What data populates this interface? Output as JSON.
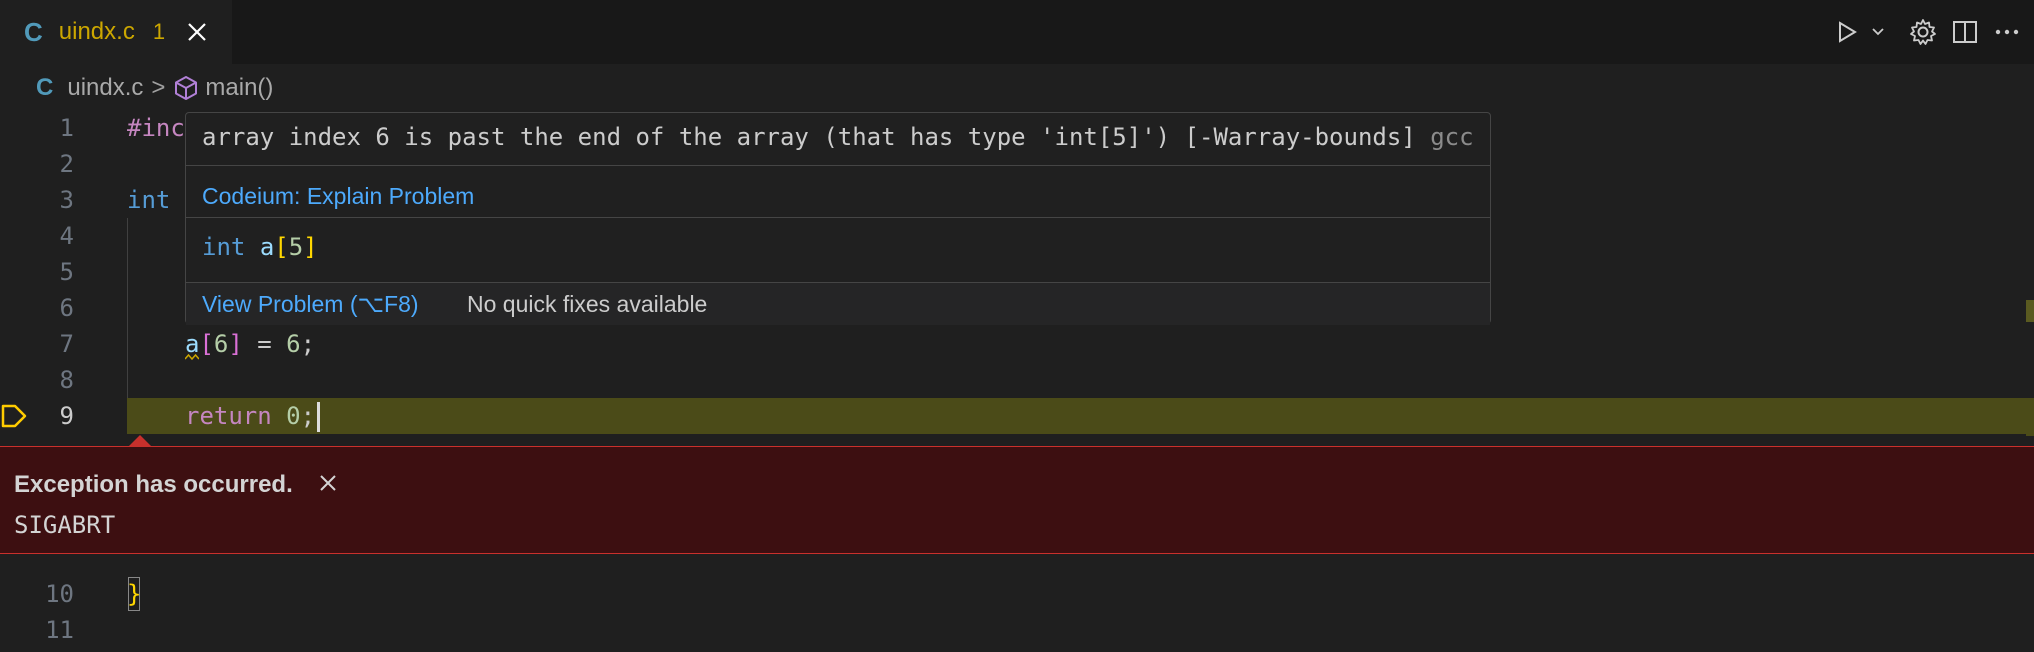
{
  "tab": {
    "lang_icon": "C",
    "label": "uindx.c",
    "problem_count": "1"
  },
  "breadcrumb": {
    "lang_icon": "C",
    "file": "uindx.c",
    "separator": ">",
    "symbol": "main()"
  },
  "editor": {
    "lines": [
      {
        "n": "1"
      },
      {
        "n": "2"
      },
      {
        "n": "3"
      },
      {
        "n": "4"
      },
      {
        "n": "5"
      },
      {
        "n": "6"
      },
      {
        "n": "7"
      },
      {
        "n": "8"
      },
      {
        "n": "9"
      },
      {
        "n": "10"
      },
      {
        "n": "11"
      }
    ],
    "line1": "#inc",
    "line3": "int",
    "line7": {
      "var": "a",
      "open": "[",
      "idx": "6",
      "close": "]",
      "rest": " = ",
      "val": "6",
      "semi": ";"
    },
    "line9": {
      "kw": "return",
      "val": "0",
      "semi": ";"
    },
    "line10": "}"
  },
  "hover": {
    "message": "array index 6 is past the end of the array (that has type 'int[5]') [-Warray-bounds]",
    "source": "gcc",
    "explain_link": "Codeium: Explain Problem",
    "decl_type": "int",
    "decl_name": "a",
    "decl_open": "[",
    "decl_size": "5",
    "decl_close": "]",
    "view_problem": "View Problem (⌥F8)",
    "no_quick_fixes": "No quick fixes available"
  },
  "exception": {
    "title": "Exception has occurred.",
    "detail": "SIGABRT"
  },
  "colors": {
    "accent": "#cca700",
    "link": "#4daafc",
    "exception_bg": "#3d0f11",
    "exception_border": "#c9302c",
    "current_line": "#4b4b18"
  },
  "icons": [
    "c-file-icon",
    "close-icon",
    "run-icon",
    "chevron-down-icon",
    "gear-icon",
    "split-editor-icon",
    "more-icon",
    "symbol-method-icon",
    "debug-stopped-icon"
  ]
}
